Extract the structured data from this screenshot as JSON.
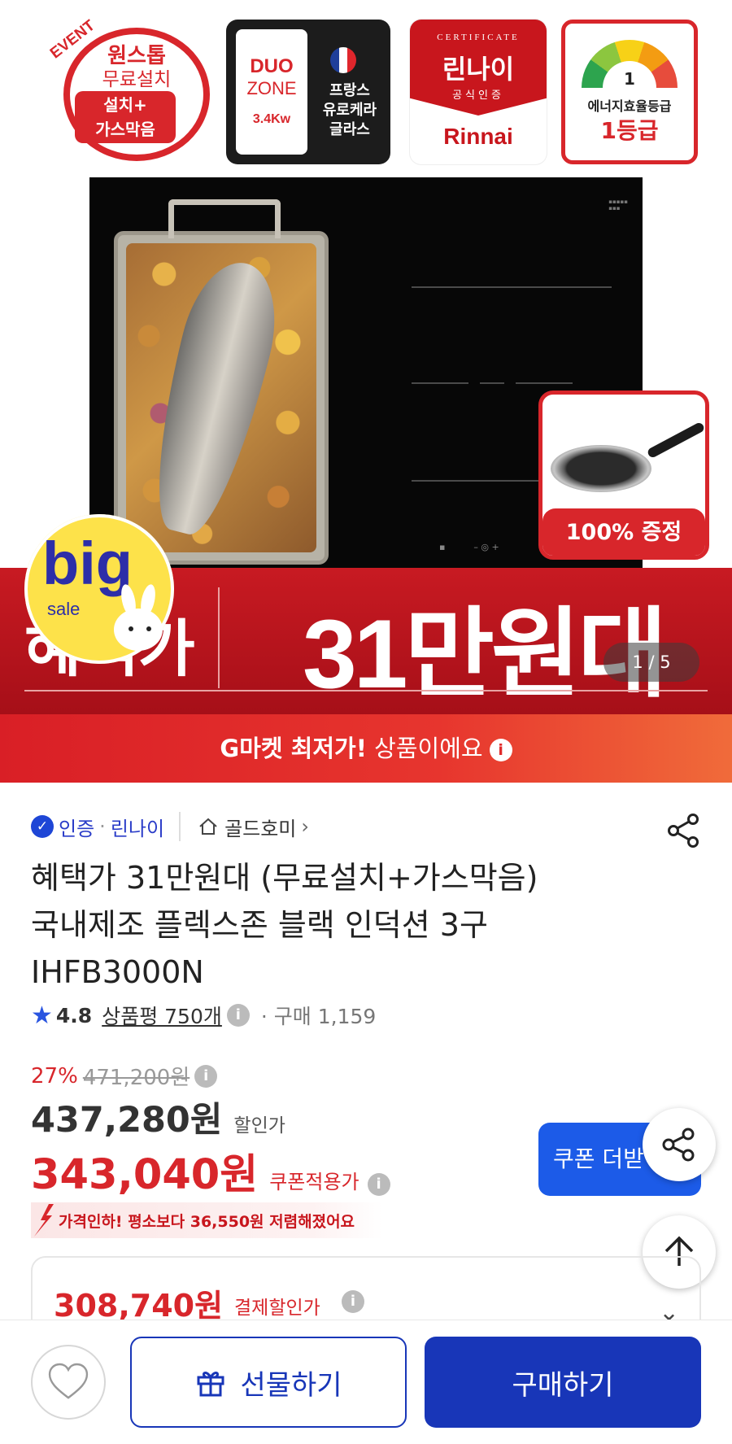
{
  "badges": {
    "event_tag": "EVENT",
    "event_line1": "원스톱",
    "event_line2": "무료설치",
    "event_box_line1": "설치+",
    "event_box_line2": "가스막음",
    "duo_line1": "DUO",
    "duo_line2": "ZONE",
    "duo_power": "3.4Kw",
    "glass_line1": "프랑스",
    "glass_line2": "유로케라",
    "glass_line3": "글라스",
    "cert_top": "CERTIFICATE",
    "cert_name": "린나이",
    "cert_official": "공식인증",
    "cert_brand": "Rinnai",
    "energy_value": "1",
    "energy_line1": "에너지효율등급",
    "energy_line2": "1등급",
    "flag_colors": [
      "#1f3f9a",
      "#ffffff",
      "#e0262c"
    ]
  },
  "hero": {
    "gift_label": "100% 증정",
    "banner_left": "혜택가",
    "banner_price": "31만원대",
    "sale_big": "big",
    "sale_small": "sale",
    "pager": "1 / 5",
    "lowest_bold": "G마켓 최저가!",
    "lowest_rest": " 상품이에요"
  },
  "product": {
    "certified": "인증",
    "brand": "린나이",
    "store": "골드호미",
    "title_line1": "혜택가 31만원대 (무료설치+가스막음)",
    "title_line2": "국내제조 플렉스존 블랙 인덕션 3구",
    "title_line3": "IHFB3000N",
    "rating": "4.8",
    "review_text": "상품평 750개",
    "purchase_text": "· 구매 1,159",
    "discount_pct": "27%",
    "original_price": "471,200원",
    "sale_price": "437,280원",
    "sale_price_label": "할인가",
    "coupon_price": "343,040원",
    "coupon_price_label": "쿠폰적용가",
    "price_cut_msg": "가격인하! 평소보다 36,550원 저렴해졌어요",
    "coupon_button": "쿠폰 더받",
    "pay_price": "308,740원",
    "pay_price_label": "결제할인가"
  },
  "bottom_bar": {
    "gift_button": "선물하기",
    "buy_button": "구매하기"
  },
  "colors": {
    "accent_red": "#d8262b",
    "brand_blue": "#1836b8",
    "coupon_blue": "#1c5be8"
  }
}
